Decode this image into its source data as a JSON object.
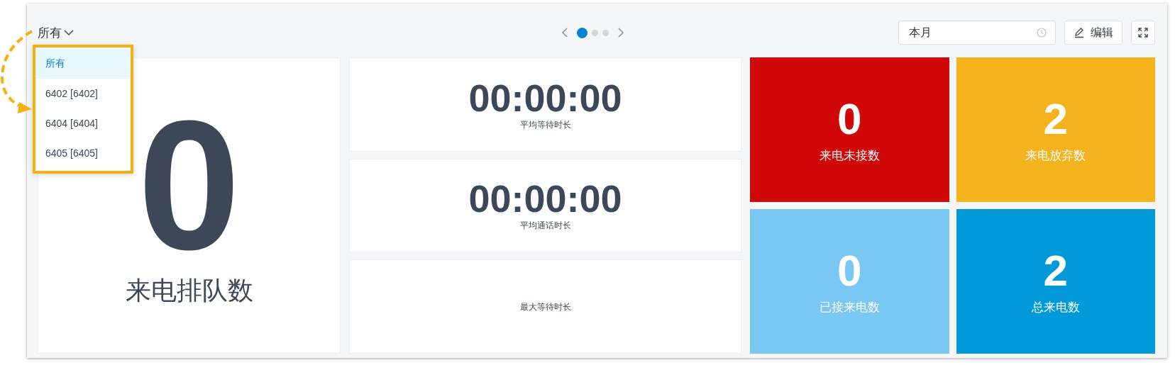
{
  "filter": {
    "label": "所有",
    "options": [
      {
        "label": "所有",
        "selected": true
      },
      {
        "label": "6402 [6402]",
        "selected": false
      },
      {
        "label": "6404 [6404]",
        "selected": false
      },
      {
        "label": "6405 [6405]",
        "selected": false
      }
    ]
  },
  "pager": [
    {
      "selected": true
    },
    {
      "selected": false
    },
    {
      "selected": false
    }
  ],
  "period": {
    "value": "本月"
  },
  "edit_button": "编辑",
  "queue_card": {
    "value": "0",
    "label": "来电排队数"
  },
  "time_cards": [
    {
      "value": "00:00:00",
      "label": "平均等待时长"
    },
    {
      "value": "00:00:00",
      "label": "平均通话时长"
    },
    {
      "label": "最大等待时长"
    }
  ],
  "tiles": [
    {
      "value": "0",
      "label": "来电未接数",
      "color": "#d10808"
    },
    {
      "value": "2",
      "label": "来电放弃数",
      "color": "#f4b31c"
    },
    {
      "value": "0",
      "label": "已接来电数",
      "color": "#79c8f4"
    },
    {
      "value": "2",
      "label": "总来电数",
      "color": "#0299db"
    }
  ]
}
